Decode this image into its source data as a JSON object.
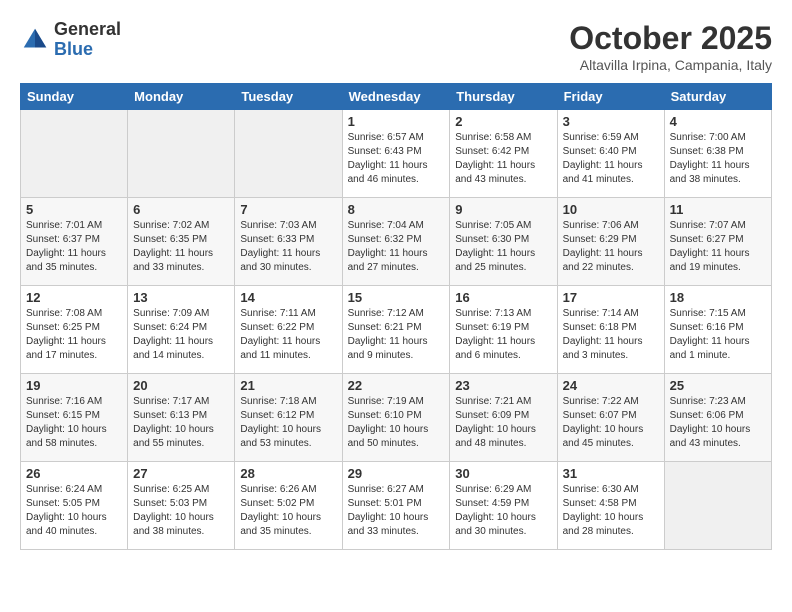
{
  "header": {
    "logo_general": "General",
    "logo_blue": "Blue",
    "month_title": "October 2025",
    "location": "Altavilla Irpina, Campania, Italy"
  },
  "days_of_week": [
    "Sunday",
    "Monday",
    "Tuesday",
    "Wednesday",
    "Thursday",
    "Friday",
    "Saturday"
  ],
  "weeks": [
    [
      {
        "day": "",
        "detail": ""
      },
      {
        "day": "",
        "detail": ""
      },
      {
        "day": "",
        "detail": ""
      },
      {
        "day": "1",
        "detail": "Sunrise: 6:57 AM\nSunset: 6:43 PM\nDaylight: 11 hours\nand 46 minutes."
      },
      {
        "day": "2",
        "detail": "Sunrise: 6:58 AM\nSunset: 6:42 PM\nDaylight: 11 hours\nand 43 minutes."
      },
      {
        "day": "3",
        "detail": "Sunrise: 6:59 AM\nSunset: 6:40 PM\nDaylight: 11 hours\nand 41 minutes."
      },
      {
        "day": "4",
        "detail": "Sunrise: 7:00 AM\nSunset: 6:38 PM\nDaylight: 11 hours\nand 38 minutes."
      }
    ],
    [
      {
        "day": "5",
        "detail": "Sunrise: 7:01 AM\nSunset: 6:37 PM\nDaylight: 11 hours\nand 35 minutes."
      },
      {
        "day": "6",
        "detail": "Sunrise: 7:02 AM\nSunset: 6:35 PM\nDaylight: 11 hours\nand 33 minutes."
      },
      {
        "day": "7",
        "detail": "Sunrise: 7:03 AM\nSunset: 6:33 PM\nDaylight: 11 hours\nand 30 minutes."
      },
      {
        "day": "8",
        "detail": "Sunrise: 7:04 AM\nSunset: 6:32 PM\nDaylight: 11 hours\nand 27 minutes."
      },
      {
        "day": "9",
        "detail": "Sunrise: 7:05 AM\nSunset: 6:30 PM\nDaylight: 11 hours\nand 25 minutes."
      },
      {
        "day": "10",
        "detail": "Sunrise: 7:06 AM\nSunset: 6:29 PM\nDaylight: 11 hours\nand 22 minutes."
      },
      {
        "day": "11",
        "detail": "Sunrise: 7:07 AM\nSunset: 6:27 PM\nDaylight: 11 hours\nand 19 minutes."
      }
    ],
    [
      {
        "day": "12",
        "detail": "Sunrise: 7:08 AM\nSunset: 6:25 PM\nDaylight: 11 hours\nand 17 minutes."
      },
      {
        "day": "13",
        "detail": "Sunrise: 7:09 AM\nSunset: 6:24 PM\nDaylight: 11 hours\nand 14 minutes."
      },
      {
        "day": "14",
        "detail": "Sunrise: 7:11 AM\nSunset: 6:22 PM\nDaylight: 11 hours\nand 11 minutes."
      },
      {
        "day": "15",
        "detail": "Sunrise: 7:12 AM\nSunset: 6:21 PM\nDaylight: 11 hours\nand 9 minutes."
      },
      {
        "day": "16",
        "detail": "Sunrise: 7:13 AM\nSunset: 6:19 PM\nDaylight: 11 hours\nand 6 minutes."
      },
      {
        "day": "17",
        "detail": "Sunrise: 7:14 AM\nSunset: 6:18 PM\nDaylight: 11 hours\nand 3 minutes."
      },
      {
        "day": "18",
        "detail": "Sunrise: 7:15 AM\nSunset: 6:16 PM\nDaylight: 11 hours\nand 1 minute."
      }
    ],
    [
      {
        "day": "19",
        "detail": "Sunrise: 7:16 AM\nSunset: 6:15 PM\nDaylight: 10 hours\nand 58 minutes."
      },
      {
        "day": "20",
        "detail": "Sunrise: 7:17 AM\nSunset: 6:13 PM\nDaylight: 10 hours\nand 55 minutes."
      },
      {
        "day": "21",
        "detail": "Sunrise: 7:18 AM\nSunset: 6:12 PM\nDaylight: 10 hours\nand 53 minutes."
      },
      {
        "day": "22",
        "detail": "Sunrise: 7:19 AM\nSunset: 6:10 PM\nDaylight: 10 hours\nand 50 minutes."
      },
      {
        "day": "23",
        "detail": "Sunrise: 7:21 AM\nSunset: 6:09 PM\nDaylight: 10 hours\nand 48 minutes."
      },
      {
        "day": "24",
        "detail": "Sunrise: 7:22 AM\nSunset: 6:07 PM\nDaylight: 10 hours\nand 45 minutes."
      },
      {
        "day": "25",
        "detail": "Sunrise: 7:23 AM\nSunset: 6:06 PM\nDaylight: 10 hours\nand 43 minutes."
      }
    ],
    [
      {
        "day": "26",
        "detail": "Sunrise: 6:24 AM\nSunset: 5:05 PM\nDaylight: 10 hours\nand 40 minutes."
      },
      {
        "day": "27",
        "detail": "Sunrise: 6:25 AM\nSunset: 5:03 PM\nDaylight: 10 hours\nand 38 minutes."
      },
      {
        "day": "28",
        "detail": "Sunrise: 6:26 AM\nSunset: 5:02 PM\nDaylight: 10 hours\nand 35 minutes."
      },
      {
        "day": "29",
        "detail": "Sunrise: 6:27 AM\nSunset: 5:01 PM\nDaylight: 10 hours\nand 33 minutes."
      },
      {
        "day": "30",
        "detail": "Sunrise: 6:29 AM\nSunset: 4:59 PM\nDaylight: 10 hours\nand 30 minutes."
      },
      {
        "day": "31",
        "detail": "Sunrise: 6:30 AM\nSunset: 4:58 PM\nDaylight: 10 hours\nand 28 minutes."
      },
      {
        "day": "",
        "detail": ""
      }
    ]
  ]
}
